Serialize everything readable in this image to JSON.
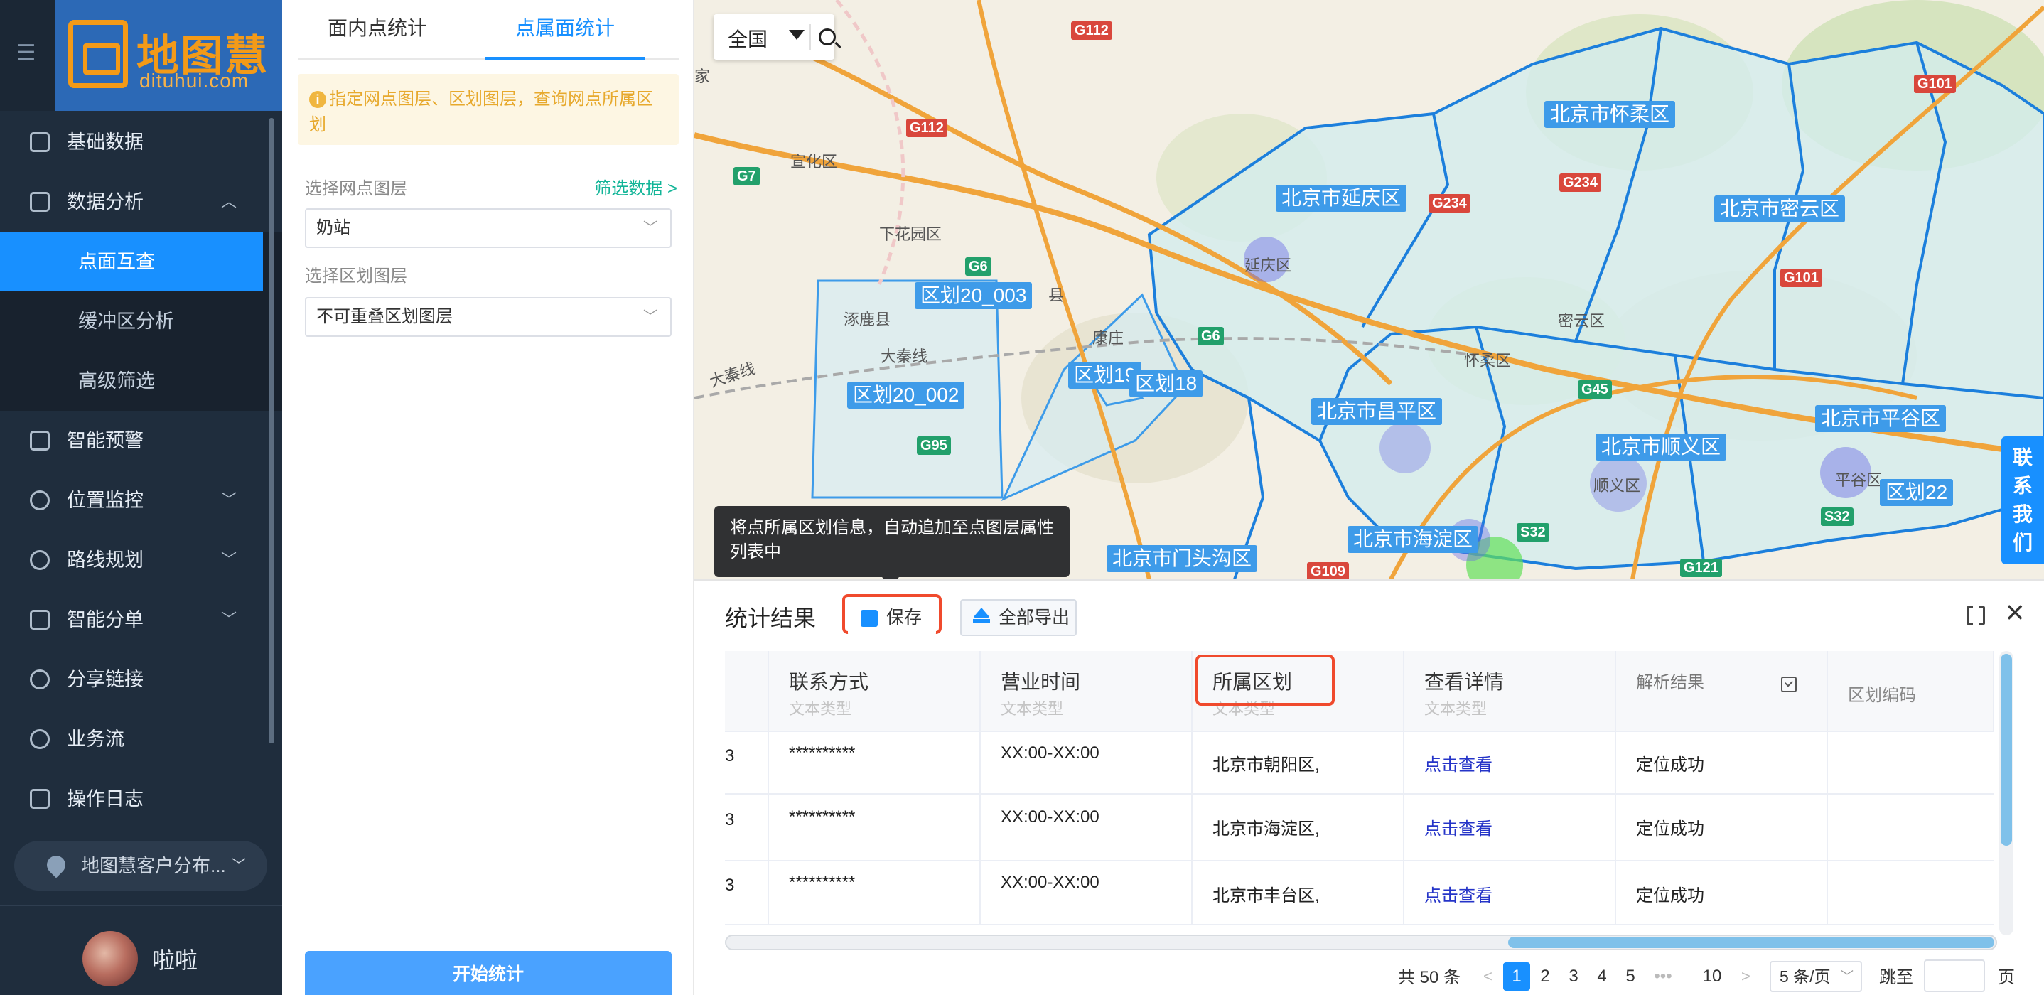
{
  "brand": {
    "cn": "地图慧",
    "en": "dituhui.com"
  },
  "nav": {
    "items": [
      {
        "label": "基础数据",
        "icon": "database-icon"
      },
      {
        "label": "数据分析",
        "icon": "analysis-icon",
        "expanded": true
      },
      {
        "label": "智能预警",
        "icon": "alert-icon"
      },
      {
        "label": "位置监控",
        "icon": "location-icon"
      },
      {
        "label": "路线规划",
        "icon": "route-icon"
      },
      {
        "label": "智能分单",
        "icon": "dispatch-icon"
      },
      {
        "label": "分享链接",
        "icon": "share-icon"
      },
      {
        "label": "业务流",
        "icon": "workflow-icon"
      },
      {
        "label": "操作日志",
        "icon": "log-icon"
      }
    ],
    "sub_items": [
      {
        "label": "点面互查",
        "active": true
      },
      {
        "label": "缓冲区分析"
      },
      {
        "label": "高级筛选"
      }
    ],
    "client_selector": "地图慧客户分布...",
    "user_name": "啦啦"
  },
  "panel": {
    "tabs": [
      {
        "label": "面内点统计"
      },
      {
        "label": "点属面统计",
        "active": true
      }
    ],
    "tip": "指定网点图层、区划图层，查询网点所属区划",
    "point_layer_label": "选择网点图层",
    "filter_link": "筛选数据 >",
    "point_layer_value": "奶站",
    "region_layer_label": "选择区划图层",
    "region_layer_value": "不可重叠区划图层",
    "start_button": "开始统计"
  },
  "map": {
    "region_selector": "全国",
    "region_labels": [
      "北京市怀柔区",
      "北京市延庆区",
      "北京市密云区",
      "区划20_003",
      "区划20_002",
      "区划19",
      "区划18",
      "北京市昌平区",
      "北京市顺义区",
      "北京市平谷区",
      "区划22",
      "北京市海淀区",
      "北京市门头沟区"
    ],
    "road_badges": [
      "G112",
      "G112",
      "G7",
      "G6",
      "G6",
      "G95",
      "G234",
      "G234",
      "G101",
      "G101",
      "S32",
      "S32",
      "G109",
      "G121",
      "G45"
    ],
    "place_names": [
      "宣化区",
      "下花园区",
      "涿鹿县",
      "延庆区",
      "密云区",
      "怀柔区",
      "顺义区",
      "平谷区",
      "大秦线",
      "大秦线",
      "康庄",
      "县",
      "家"
    ],
    "tooltip": "将点所属区划信息，自动追加至点图层属性列表中",
    "contact_tab": [
      "联",
      "系",
      "我",
      "们"
    ]
  },
  "results": {
    "title": "统计结果",
    "save_button": "保存",
    "export_button": "全部导出",
    "columns": [
      {
        "label": "联系方式",
        "sub": "文本类型"
      },
      {
        "label": "营业时间",
        "sub": "文本类型"
      },
      {
        "label": "所属区划",
        "sub": "文本类型"
      },
      {
        "label": "查看详情",
        "sub": "文本类型"
      },
      {
        "label": "解析结果"
      },
      {
        "label": "区划编码"
      }
    ],
    "rows": [
      {
        "first": "3",
        "contact": "**********",
        "hours": "XX:00-XX:00",
        "region": "北京市朝阳区,",
        "detail": "点击查看",
        "parse": "定位成功",
        "code": ""
      },
      {
        "first": "3",
        "contact": "**********",
        "hours": "XX:00-XX:00",
        "region": "北京市海淀区,",
        "detail": "点击查看",
        "parse": "定位成功",
        "code": ""
      },
      {
        "first": "3",
        "contact": "**********",
        "hours": "XX:00-XX:00",
        "region": "北京市丰台区,",
        "detail": "点击查看",
        "parse": "定位成功",
        "code": ""
      }
    ],
    "pagination": {
      "total": "共 50 条",
      "prev": "<",
      "pages": [
        "1",
        "2",
        "3",
        "4",
        "5"
      ],
      "ellipsis": "•••",
      "last": "10",
      "next": ">",
      "page_size": "5 条/页",
      "jump_label": "跳至",
      "page_suffix": "页",
      "current": 1
    }
  },
  "colors": {
    "accent": "#1890ff",
    "nav_bg": "#1f2d3d",
    "highlight_border": "#f04a2d",
    "region_label_bg": "#3e9be9",
    "link": "#2534c8"
  }
}
